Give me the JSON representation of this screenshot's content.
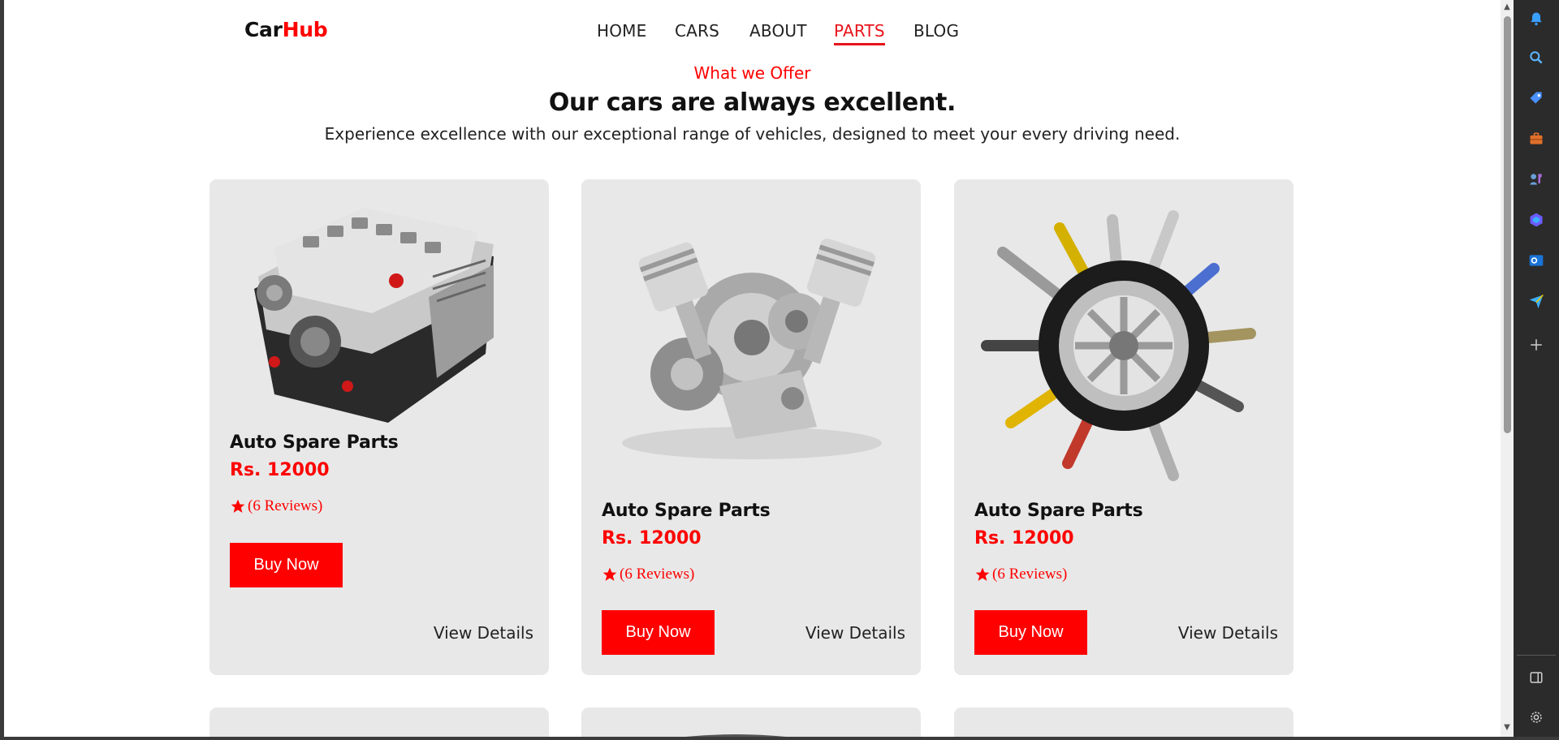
{
  "brand": {
    "prefix": "Car",
    "accent": "Hub"
  },
  "nav": {
    "items": [
      {
        "label": "HOME",
        "active": false
      },
      {
        "label": "CARS",
        "active": false
      },
      {
        "label": "ABOUT",
        "active": false
      },
      {
        "label": "PARTS",
        "active": true
      },
      {
        "label": "BLOG",
        "active": false
      }
    ]
  },
  "section": {
    "kicker": "What we Offer",
    "headline": "Our cars are always excellent.",
    "subtext": "Experience excellence with our exceptional range of vehicles, designed to meet your every driving need."
  },
  "products": [
    {
      "title": "Auto Spare Parts",
      "price": "Rs. 12000",
      "rating": "(6  Reviews)",
      "buy_label": "Buy Now",
      "details_label": "View Details",
      "image": "engine-block-image"
    },
    {
      "title": "Auto Spare Parts",
      "price": "Rs. 12000",
      "rating": "(6  Reviews)",
      "buy_label": "Buy Now",
      "details_label": "View Details",
      "image": "piston-gears-image"
    },
    {
      "title": "Auto Spare Parts",
      "price": "Rs. 12000",
      "rating": "(6  Reviews)",
      "buy_label": "Buy Now",
      "details_label": "View Details",
      "image": "tire-parts-image"
    }
  ],
  "colors": {
    "accent": "#ff0000",
    "card_bg": "#e8e8e8",
    "nav_active": "#e8141b"
  },
  "sidepanel_icons": [
    "bell-icon",
    "search-icon",
    "tag-icon",
    "briefcase-icon",
    "chess-icon",
    "copilot-icon",
    "outlook-icon",
    "send-icon",
    "plus-icon",
    "sidebar-toggle-icon",
    "settings-icon"
  ]
}
